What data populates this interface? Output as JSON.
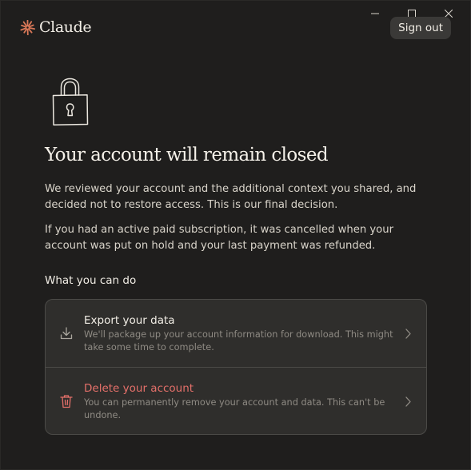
{
  "window": {
    "controls": [
      "minimize",
      "maximize",
      "close"
    ]
  },
  "header": {
    "brand_name": "Claude",
    "brand_icon": "claude-sunburst-icon",
    "brand_color": "#d97757",
    "signout_label": "Sign out"
  },
  "hero": {
    "icon": "lock-icon",
    "title": "Your account will remain closed",
    "paragraph1": "We reviewed your account and the additional context you shared, and decided not to restore access. This is our final decision.",
    "paragraph2": "If you had an active paid subscription, it was cancelled when your account was put on hold and your last payment was refunded."
  },
  "actions": {
    "section_label": "What you can do",
    "items": [
      {
        "icon": "download-icon",
        "title": "Export your data",
        "description": "We'll package up your account information for download. This might take some time to complete."
      },
      {
        "icon": "trash-icon",
        "title": "Delete your account",
        "description": "You can permanently remove your account and data. This can't be undone.",
        "color": "#e5706a"
      }
    ]
  }
}
